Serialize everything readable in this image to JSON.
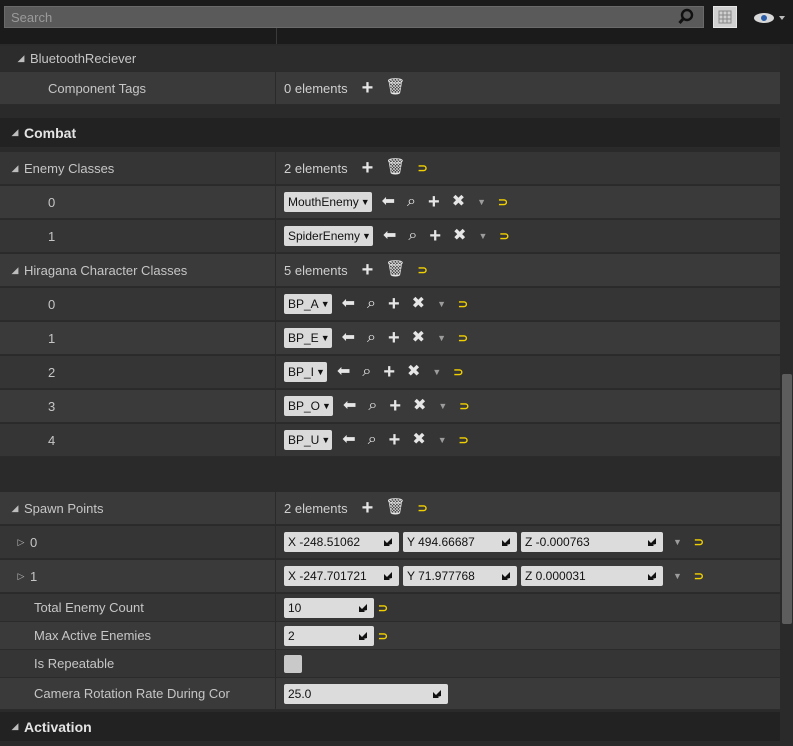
{
  "search": {
    "placeholder": "Search"
  },
  "sections": {
    "bluetooth": {
      "title": "BluetoothReciever",
      "tags_label": "Component Tags",
      "tags_count": "0 elements"
    },
    "combat": {
      "title": "Combat",
      "enemy_classes": {
        "label": "Enemy Classes",
        "count": "2 elements",
        "items": [
          {
            "index": "0",
            "value": "MouthEnemy"
          },
          {
            "index": "1",
            "value": "SpiderEnemy"
          }
        ]
      },
      "hiragana": {
        "label": "Hiragana Character Classes",
        "count": "5 elements",
        "items": [
          {
            "index": "0",
            "value": "BP_A"
          },
          {
            "index": "1",
            "value": "BP_E"
          },
          {
            "index": "2",
            "value": "BP_I"
          },
          {
            "index": "3",
            "value": "BP_O"
          },
          {
            "index": "4",
            "value": "BP_U"
          }
        ]
      },
      "spawn_points": {
        "label": "Spawn Points",
        "count": "2 elements",
        "items": [
          {
            "index": "0",
            "x": "X  -248.51062",
            "y": "Y  494.66687",
            "z": "Z  -0.000763"
          },
          {
            "index": "1",
            "x": "X  -247.701721",
            "y": "Y  71.977768",
            "z": "Z  0.000031"
          }
        ]
      },
      "total_enemy": {
        "label": "Total Enemy Count",
        "value": "10"
      },
      "max_active": {
        "label": "Max Active Enemies",
        "value": "2"
      },
      "repeatable": {
        "label": "Is Repeatable",
        "checked": false
      },
      "camera_rate": {
        "label": "Camera Rotation Rate During Cor",
        "value": "25.0"
      }
    },
    "activation": {
      "title": "Activation"
    }
  },
  "icons": {
    "plus": "+",
    "trash": "🗑",
    "reset": "⊃",
    "back": "⬅",
    "browse": "⌕",
    "remove": "✖",
    "dropdown": "▾"
  },
  "colors": {
    "reset_arrow": "#f0d000",
    "row_bg": "#353535",
    "category_bg": "#222222"
  }
}
